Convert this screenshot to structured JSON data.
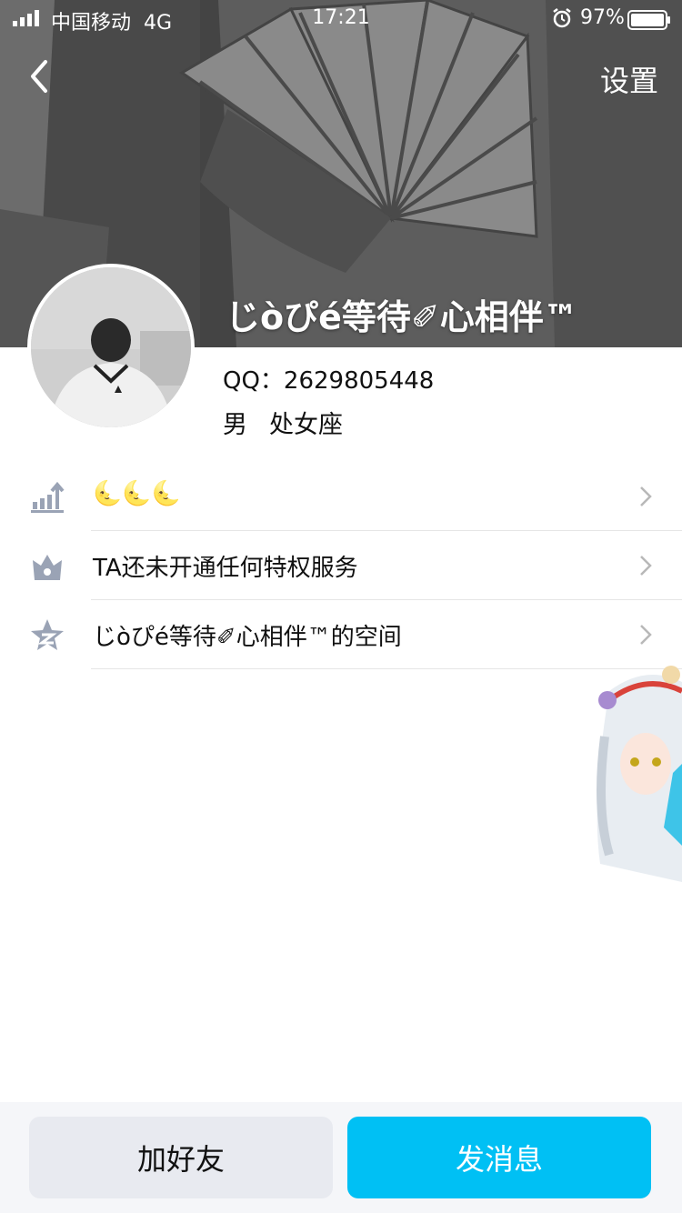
{
  "status_bar": {
    "carrier": "中国移动",
    "network": "4G",
    "time": "17:21",
    "battery": "97%"
  },
  "header": {
    "settings_label": "设置"
  },
  "profile": {
    "nickname": "じòぴé等待✐心相伴™",
    "qq": "QQ：2629805448",
    "gender": "男",
    "zodiac": "处女座"
  },
  "list": {
    "items": [
      {
        "icon": "level-chart-icon",
        "label": "🌜🌜🌜"
      },
      {
        "icon": "crown-icon",
        "label": "TA还未开通任何特权服务"
      },
      {
        "icon": "qzone-star-icon",
        "label": "じòぴé等待✐心相伴™的空间"
      }
    ]
  },
  "actions": {
    "add_friend": "加好友",
    "send_message": "发消息"
  },
  "colors": {
    "primary": "#00c0f4",
    "secondary_button": "#e8eaf0",
    "icon_gray": "#9aa3b5"
  }
}
